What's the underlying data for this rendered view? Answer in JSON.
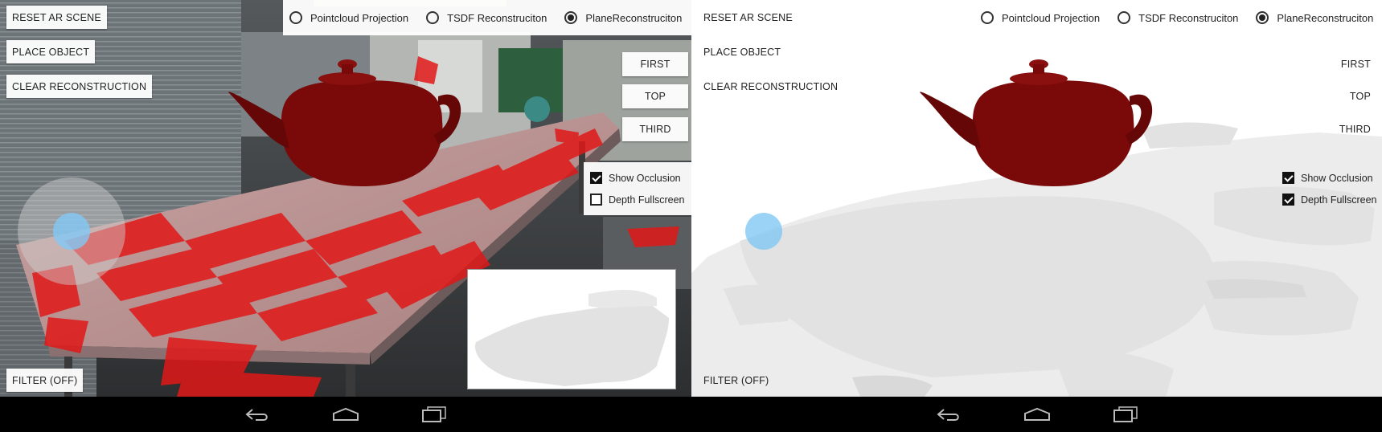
{
  "left": {
    "buttons": {
      "reset": "RESET AR SCENE",
      "place": "PLACE OBJECT",
      "clear": "CLEAR RECONSTRUCTION",
      "filter": "FILTER (OFF)"
    },
    "modes": [
      {
        "label": "Pointcloud Projection",
        "selected": false
      },
      {
        "label": "TSDF Reconstruciton",
        "selected": false
      },
      {
        "label": "PlaneReconstruciton",
        "selected": true
      }
    ],
    "views": {
      "first": "FIRST",
      "top": "TOP",
      "third": "THIRD"
    },
    "options": {
      "occlusion": {
        "label": "Show Occlusion",
        "checked": true
      },
      "depth": {
        "label": "Depth Fullscreen",
        "checked": false
      }
    }
  },
  "right": {
    "buttons": {
      "reset": "RESET AR SCENE",
      "place": "PLACE OBJECT",
      "clear": "CLEAR RECONSTRUCTION",
      "filter": "FILTER (OFF)"
    },
    "modes": [
      {
        "label": "Pointcloud Projection",
        "selected": false
      },
      {
        "label": "TSDF Reconstruciton",
        "selected": false
      },
      {
        "label": "PlaneReconstruciton",
        "selected": true
      }
    ],
    "views": {
      "first": "FIRST",
      "top": "TOP",
      "third": "THIRD"
    },
    "options": {
      "occlusion": {
        "label": "Show Occlusion",
        "checked": true
      },
      "depth": {
        "label": "Depth Fullscreen",
        "checked": true
      }
    }
  },
  "colors": {
    "teapot": "#7a0a0a",
    "plane_overlay": "#e01818",
    "joystick_knob": "#82c8f5",
    "depth_gray": "#e6e6e6"
  }
}
